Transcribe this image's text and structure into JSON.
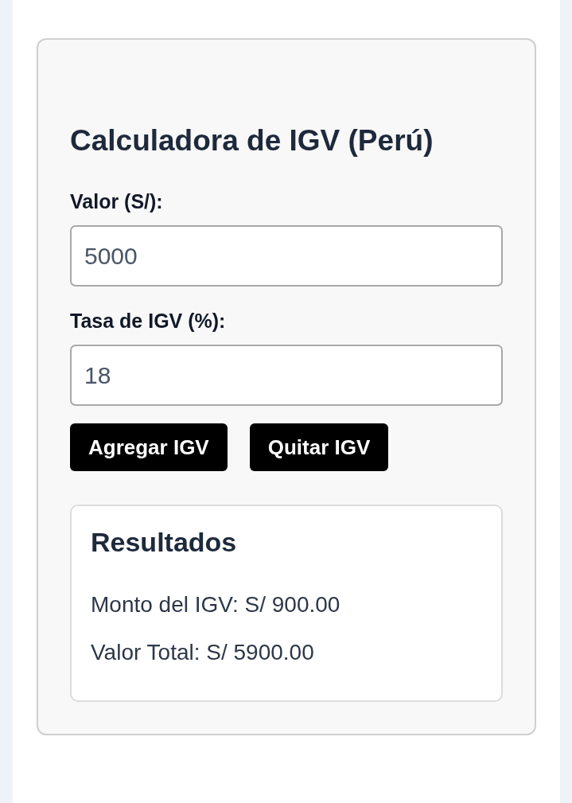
{
  "title": "Calculadora de IGV (Perú)",
  "fields": [
    {
      "label": "Valor (S/):",
      "value": "5000"
    },
    {
      "label": "Tasa de IGV (%):",
      "value": "18"
    }
  ],
  "buttons": [
    "Agregar IGV",
    "Quitar IGV"
  ],
  "results": {
    "title": "Resultados",
    "lines": [
      "Monto del IGV: S/ 900.00",
      "Valor Total: S/ 5900.00"
    ]
  }
}
